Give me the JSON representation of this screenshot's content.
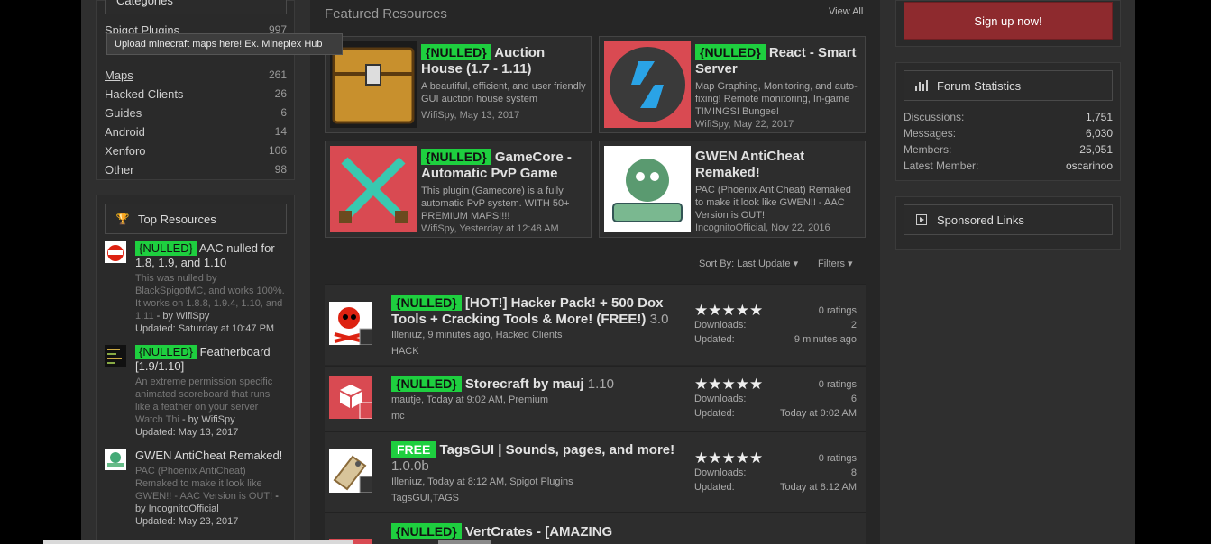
{
  "categories": {
    "heading": "Categories",
    "items": [
      {
        "label": "Spigot Plugins",
        "count": "997"
      },
      {
        "label": "Maps",
        "count": "261"
      },
      {
        "label": "Hacked Clients",
        "count": "26"
      },
      {
        "label": "Guides",
        "count": "6"
      },
      {
        "label": "Android",
        "count": "14"
      },
      {
        "label": "Xenforo",
        "count": "106"
      },
      {
        "label": "Other",
        "count": "98"
      }
    ],
    "tooltip": "Upload minecraft maps here! Ex. Mineplex Hub"
  },
  "top_resources": {
    "heading": "Top Resources",
    "items": [
      {
        "tag": "{NULLED}",
        "title": "AAC nulled for 1.8, 1.9, and 1.10",
        "desc": "This was nulled by BlackSpigotMC, and works 100%. It works on 1.8.8, 1.9.4, 1.10, and 1.11",
        "by": " - by WifiSpy",
        "updated": "Updated: Saturday at 10:47 PM"
      },
      {
        "tag": "{NULLED}",
        "title": "Featherboard [1.9/1.10]",
        "desc": "An extreme permission specific animated scoreboard that runs like a feather on your server Watch Thi",
        "by": " - by WifiSpy",
        "updated": "Updated: May 13, 2017"
      },
      {
        "tag": "",
        "title": "GWEN AntiCheat Remaked!",
        "desc": "PAC (Phoenix AntiCheat) Remaked to make it look like GWEN!! - AAC Version is OUT!",
        "by": " - by IncognitoOfficial",
        "updated": "Updated: May 23, 2017"
      }
    ]
  },
  "featured": {
    "heading": "Featured Resources",
    "view_all": "View All",
    "items": [
      {
        "tag": "{NULLED}",
        "title": "Auction House (1.7 - 1.11)",
        "desc": "A beautiful, efficient, and user friendly GUI auction house system",
        "meta": "WifiSpy, May 13, 2017"
      },
      {
        "tag": "{NULLED}",
        "title": "React - Smart Server",
        "desc": "Map Graphing, Monitoring, and auto-fixing! Remote monitoring, In-game TIMINGS! Bungee!",
        "meta": "WifiSpy, May 22, 2017"
      },
      {
        "tag": "{NULLED}",
        "title": "GameCore - Automatic PvP Game",
        "desc": "This plugin (Gamecore) is a fully automatic PvP system. WITH 50+ PREMIUM MAPS!!!!",
        "meta": "WifiSpy, Yesterday at 12:48 AM"
      },
      {
        "tag": "",
        "title": "GWEN AntiCheat Remaked!",
        "desc": "PAC (Phoenix AntiCheat) Remaked to make it look like GWEN!! - AAC Version is OUT!",
        "meta": "IncognitoOfficial, Nov 22, 2016"
      }
    ]
  },
  "sort": {
    "label": "Sort By:",
    "value": "Last Update",
    "filters": "Filters"
  },
  "resources": [
    {
      "tag": "{NULLED}",
      "title": "[HOT!] Hacker Pack! + 500 Dox Tools + Cracking Tools & More! (FREE!)",
      "version": "3.0",
      "meta": "Illeniuz, 9 minutes ago, Hacked Clients",
      "tags": "HACK",
      "ratings": "0 ratings",
      "downloads_label": "Downloads:",
      "downloads": "2",
      "updated_label": "Updated:",
      "updated": "9 minutes ago",
      "stars": "★★★★★"
    },
    {
      "tag": "{NULLED}",
      "title": "Storecraft by mauj",
      "version": "1.10",
      "meta": "mautje, Today at 9:02 AM, Premium",
      "tags": "mc",
      "ratings": "0 ratings",
      "downloads_label": "Downloads:",
      "downloads": "6",
      "updated_label": "Updated:",
      "updated": "Today at 9:02 AM",
      "stars": "★★★★★"
    },
    {
      "tag": "FREE",
      "title": "TagsGUI | Sounds, pages, and more!",
      "version": "1.0.0b",
      "meta": "Illeniuz, Today at 8:12 AM, Spigot Plugins",
      "tags": "TagsGUI,TAGS",
      "ratings": "0 ratings",
      "downloads_label": "Downloads:",
      "downloads": "8",
      "updated_label": "Updated:",
      "updated": "Today at 8:12 AM",
      "stars": "★★★★★"
    },
    {
      "tag": "{NULLED}",
      "title": "VertCrates - [AMAZING",
      "version": "",
      "meta": "",
      "tags": "",
      "ratings": "",
      "downloads_label": "",
      "downloads": "",
      "updated_label": "",
      "updated": "",
      "stars": ""
    }
  ],
  "sidebar": {
    "signup": "Sign up now!",
    "forum_stats": {
      "heading": "Forum Statistics",
      "rows": [
        {
          "label": "Discussions:",
          "value": "1,751"
        },
        {
          "label": "Messages:",
          "value": "6,030"
        },
        {
          "label": "Members:",
          "value": "25,051"
        },
        {
          "label": "Latest Member:",
          "value": "oscarinoo"
        }
      ]
    },
    "sponsored": {
      "heading": "Sponsored Links"
    }
  },
  "colors": {
    "nulled_tag": "#1ecf3f",
    "signup": "#8e2a2e",
    "background": "#2f2f2f"
  }
}
